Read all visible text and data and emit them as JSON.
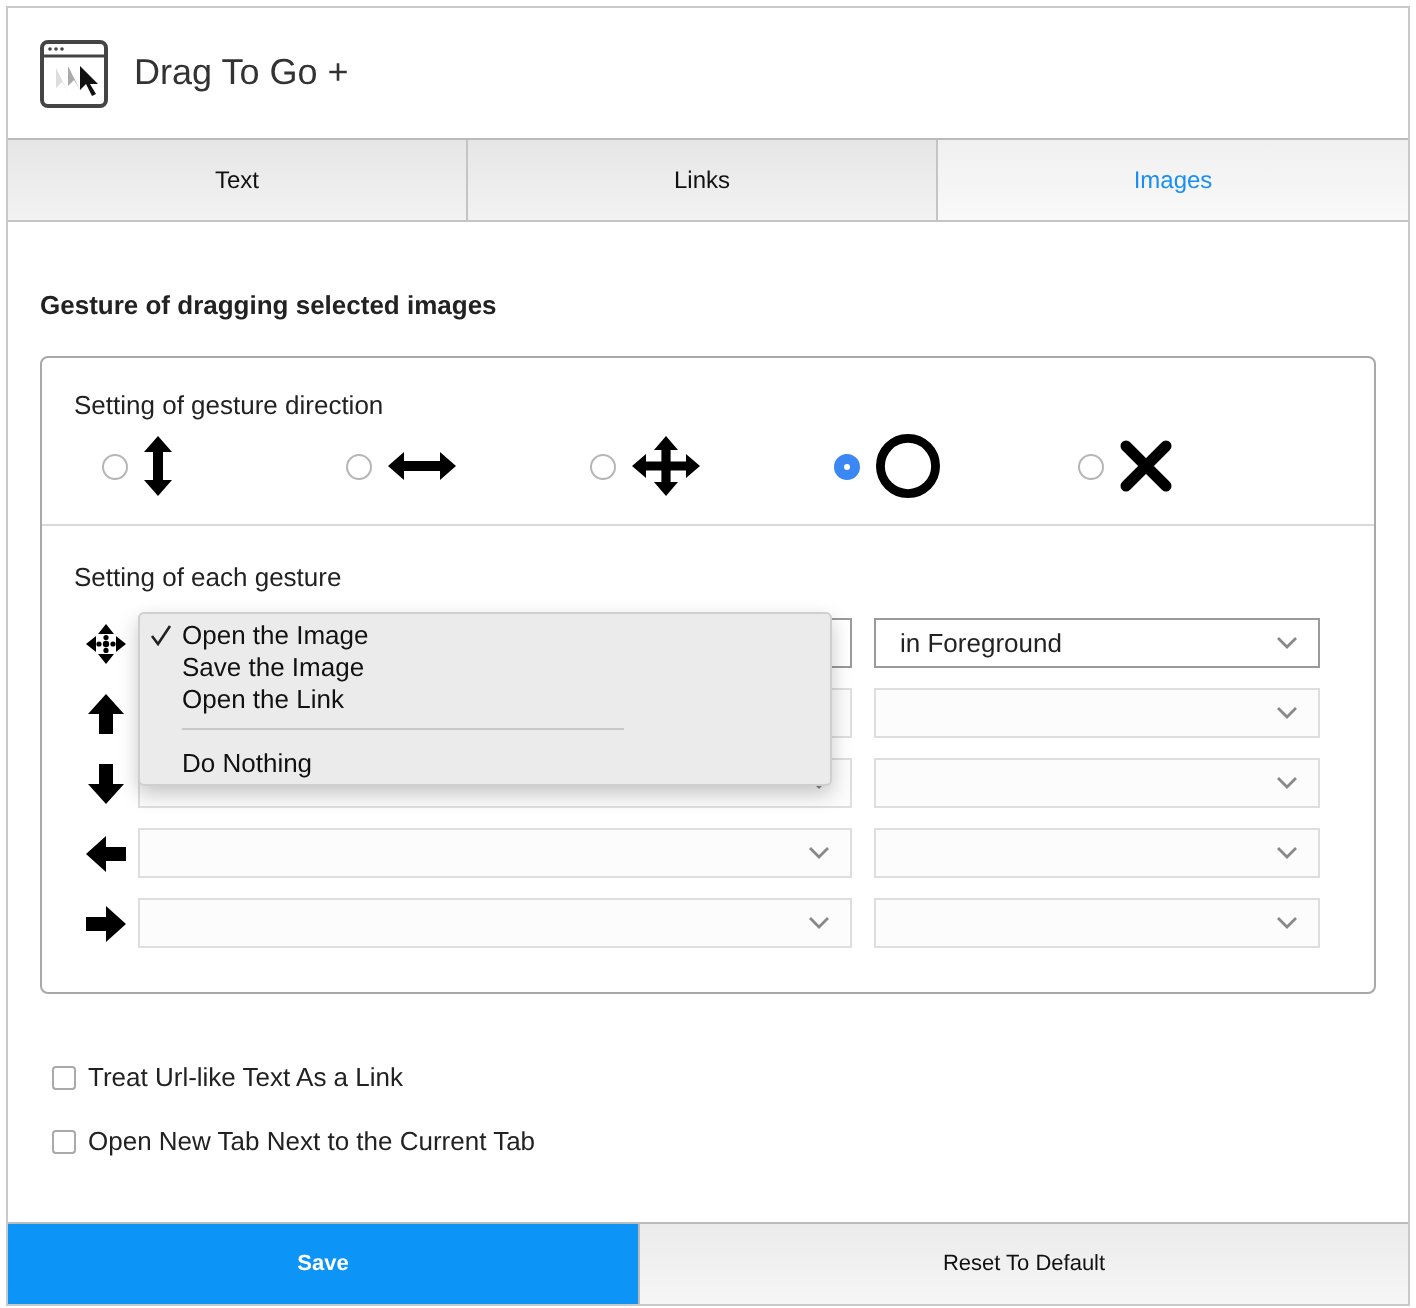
{
  "header": {
    "title": "Drag To Go +"
  },
  "tabs": [
    {
      "label": "Text",
      "selected": false
    },
    {
      "label": "Links",
      "selected": false
    },
    {
      "label": "Images",
      "selected": true
    }
  ],
  "section_heading": "Gesture of dragging selected images",
  "direction": {
    "label": "Setting of gesture direction",
    "options": [
      {
        "kind": "vertical",
        "selected": false
      },
      {
        "kind": "horizontal",
        "selected": false
      },
      {
        "kind": "four-way",
        "selected": false
      },
      {
        "kind": "circle",
        "selected": true
      },
      {
        "kind": "cross",
        "selected": false
      }
    ]
  },
  "gestures": {
    "label": "Setting of each gesture",
    "rows": [
      {
        "kind": "any",
        "action_disabled": false,
        "target": "in Foreground",
        "target_disabled": false
      },
      {
        "kind": "up",
        "action_disabled": true,
        "target_disabled": true
      },
      {
        "kind": "down",
        "action_disabled": true,
        "target_disabled": true
      },
      {
        "kind": "left",
        "action_disabled": true,
        "target_disabled": true
      },
      {
        "kind": "right",
        "action_disabled": true,
        "target_disabled": true
      }
    ]
  },
  "gesture_menu": {
    "items": [
      {
        "kind": "option",
        "label": "Open the Image",
        "selected": true
      },
      {
        "kind": "option",
        "label": "Save the Image",
        "selected": false
      },
      {
        "kind": "option",
        "label": "Open the Link",
        "selected": false
      },
      {
        "kind": "separator"
      },
      {
        "kind": "option",
        "label": "Do Nothing",
        "selected": false
      }
    ]
  },
  "options": [
    {
      "label": "Treat Url-like Text As a Link",
      "checked": false
    },
    {
      "label": "Open New Tab Next to the Current Tab",
      "checked": false
    }
  ],
  "footer": [
    {
      "label": "Save",
      "kind": "primary"
    },
    {
      "label": "Reset To Default",
      "kind": "default"
    }
  ]
}
